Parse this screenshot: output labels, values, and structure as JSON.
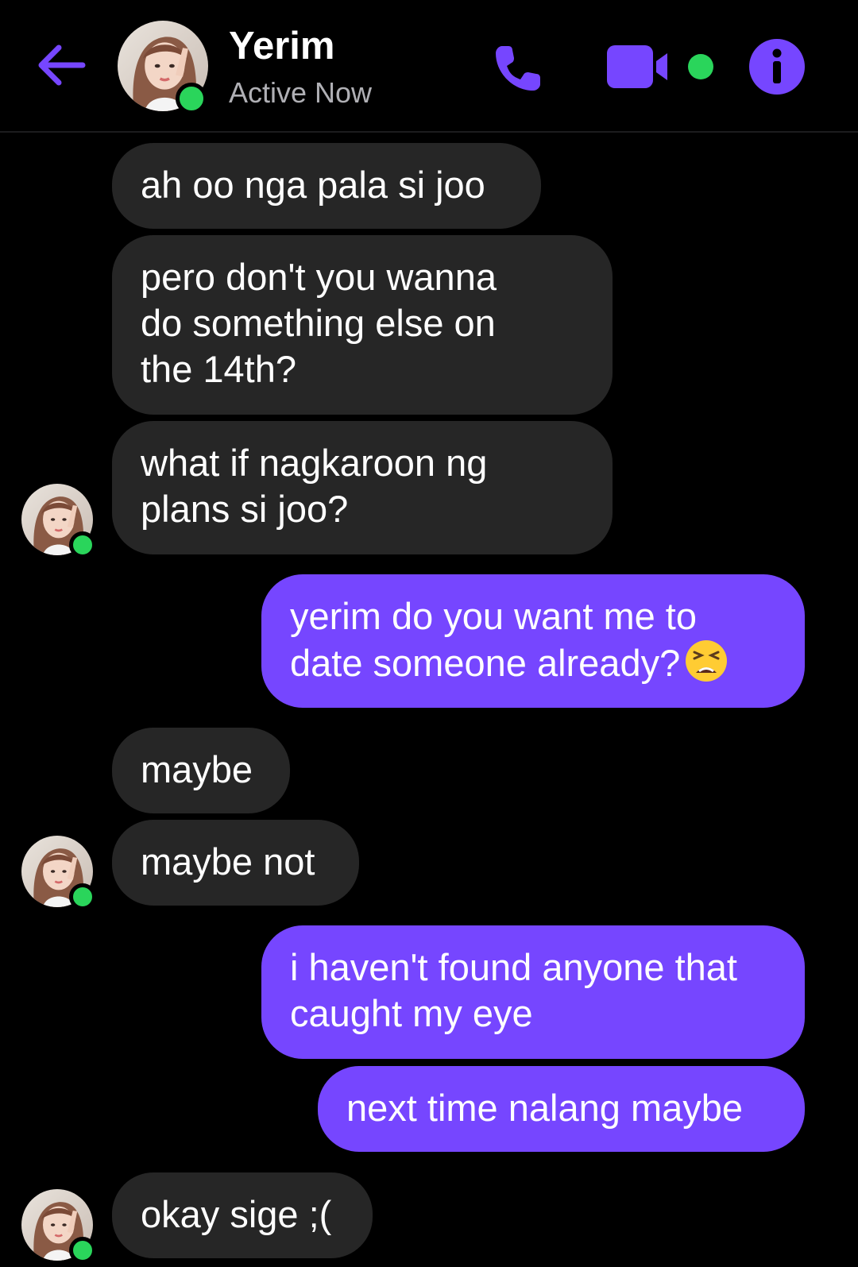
{
  "colors": {
    "accent": "#7646ff",
    "incoming_bubble": "#262626",
    "presence": "#2ad55b",
    "background": "#000000"
  },
  "header": {
    "back_icon": "arrow-left-icon",
    "contact_name": "Yerim",
    "status": "Active Now",
    "icons": [
      "phone-icon",
      "video-camera-icon",
      "info-icon"
    ]
  },
  "messages": [
    {
      "from": "contact",
      "lines": [
        "ah oo nga pala si joo"
      ]
    },
    {
      "from": "contact",
      "lines": [
        "pero don't you wanna",
        "do something else on",
        "the 14th?"
      ]
    },
    {
      "from": "contact",
      "lines": [
        "what if nagkaroon ng",
        "plans si joo?"
      ]
    },
    {
      "from": "me",
      "lines": [
        "yerim do you want me to",
        "date someone already?"
      ],
      "emoji": "tired-face-emoji"
    },
    {
      "from": "contact",
      "lines": [
        "maybe"
      ]
    },
    {
      "from": "contact",
      "lines": [
        "maybe not"
      ]
    },
    {
      "from": "me",
      "lines": [
        "i haven't found anyone that",
        "caught my eye"
      ]
    },
    {
      "from": "me",
      "lines": [
        "next time nalang maybe"
      ]
    },
    {
      "from": "contact",
      "lines": [
        "okay sige ;("
      ]
    }
  ]
}
